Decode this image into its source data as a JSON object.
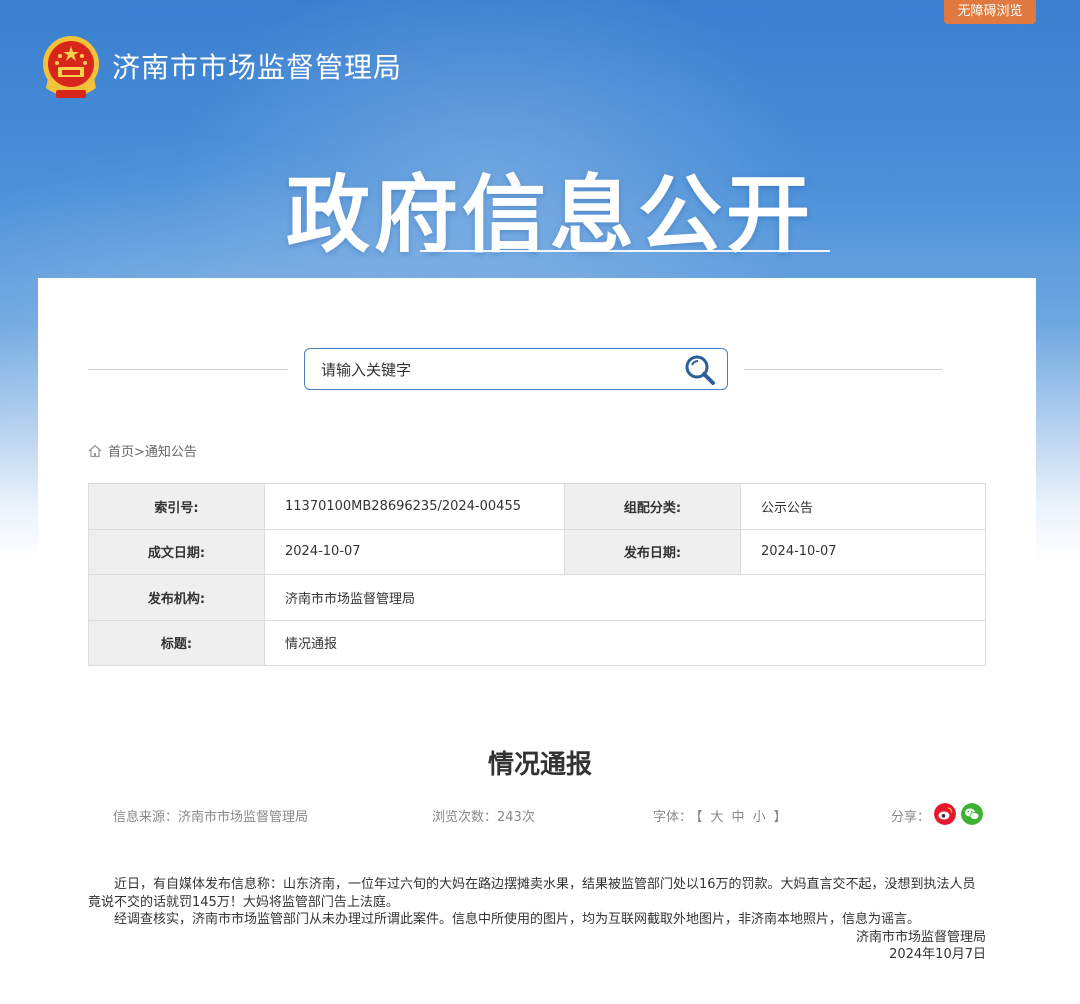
{
  "header": {
    "accessibility_label": "无障碍浏览",
    "site_title": "济南市市场监督管理局",
    "banner_title": "政府信息公开"
  },
  "search": {
    "placeholder": "请输入关键字"
  },
  "breadcrumb": {
    "home": "首页",
    "separator": ">",
    "current": "通知公告"
  },
  "info_table": {
    "rows": [
      {
        "label": "索引号:",
        "value": "11370100MB28696235/2024-00455",
        "label2": "组配分类:",
        "value2": "公示公告"
      },
      {
        "label": "成文日期:",
        "value": "2024-10-07",
        "label2": "发布日期:",
        "value2": "2024-10-07"
      },
      {
        "label": "发布机构:",
        "value": "济南市市场监督管理局"
      },
      {
        "label": "标题:",
        "value": "情况通报"
      }
    ]
  },
  "article": {
    "title": "情况通报",
    "source_label": "信息来源：济南市市场监督管理局",
    "views_label": "浏览次数：243次",
    "font_label": "字体：",
    "font_open": "【",
    "font_large": "大",
    "font_medium": "中",
    "font_small": "小",
    "font_close": "】",
    "share_label": "分享：",
    "paragraph1": "近日，有自媒体发布信息称：山东济南，一位年过六旬的大妈在路边摆摊卖水果，结果被监管部门处以16万的罚款。大妈直言交不起，没想到执法人员竟说不交的话就罚145万！大妈将监管部门告上法庭。",
    "paragraph2": "经调查核实，济南市市场监管部门从未办理过所谓此案件。信息中所使用的图片，均为互联网截取外地图片，非济南本地照片，信息为谣言。",
    "signature": "济南市市场监督管理局",
    "date": "2024年10月7日"
  },
  "colors": {
    "accessibility_bg": "#e0793f",
    "search_border": "#4a7fbf",
    "weibo_red": "#e6162d",
    "wechat_green": "#3eb135"
  }
}
